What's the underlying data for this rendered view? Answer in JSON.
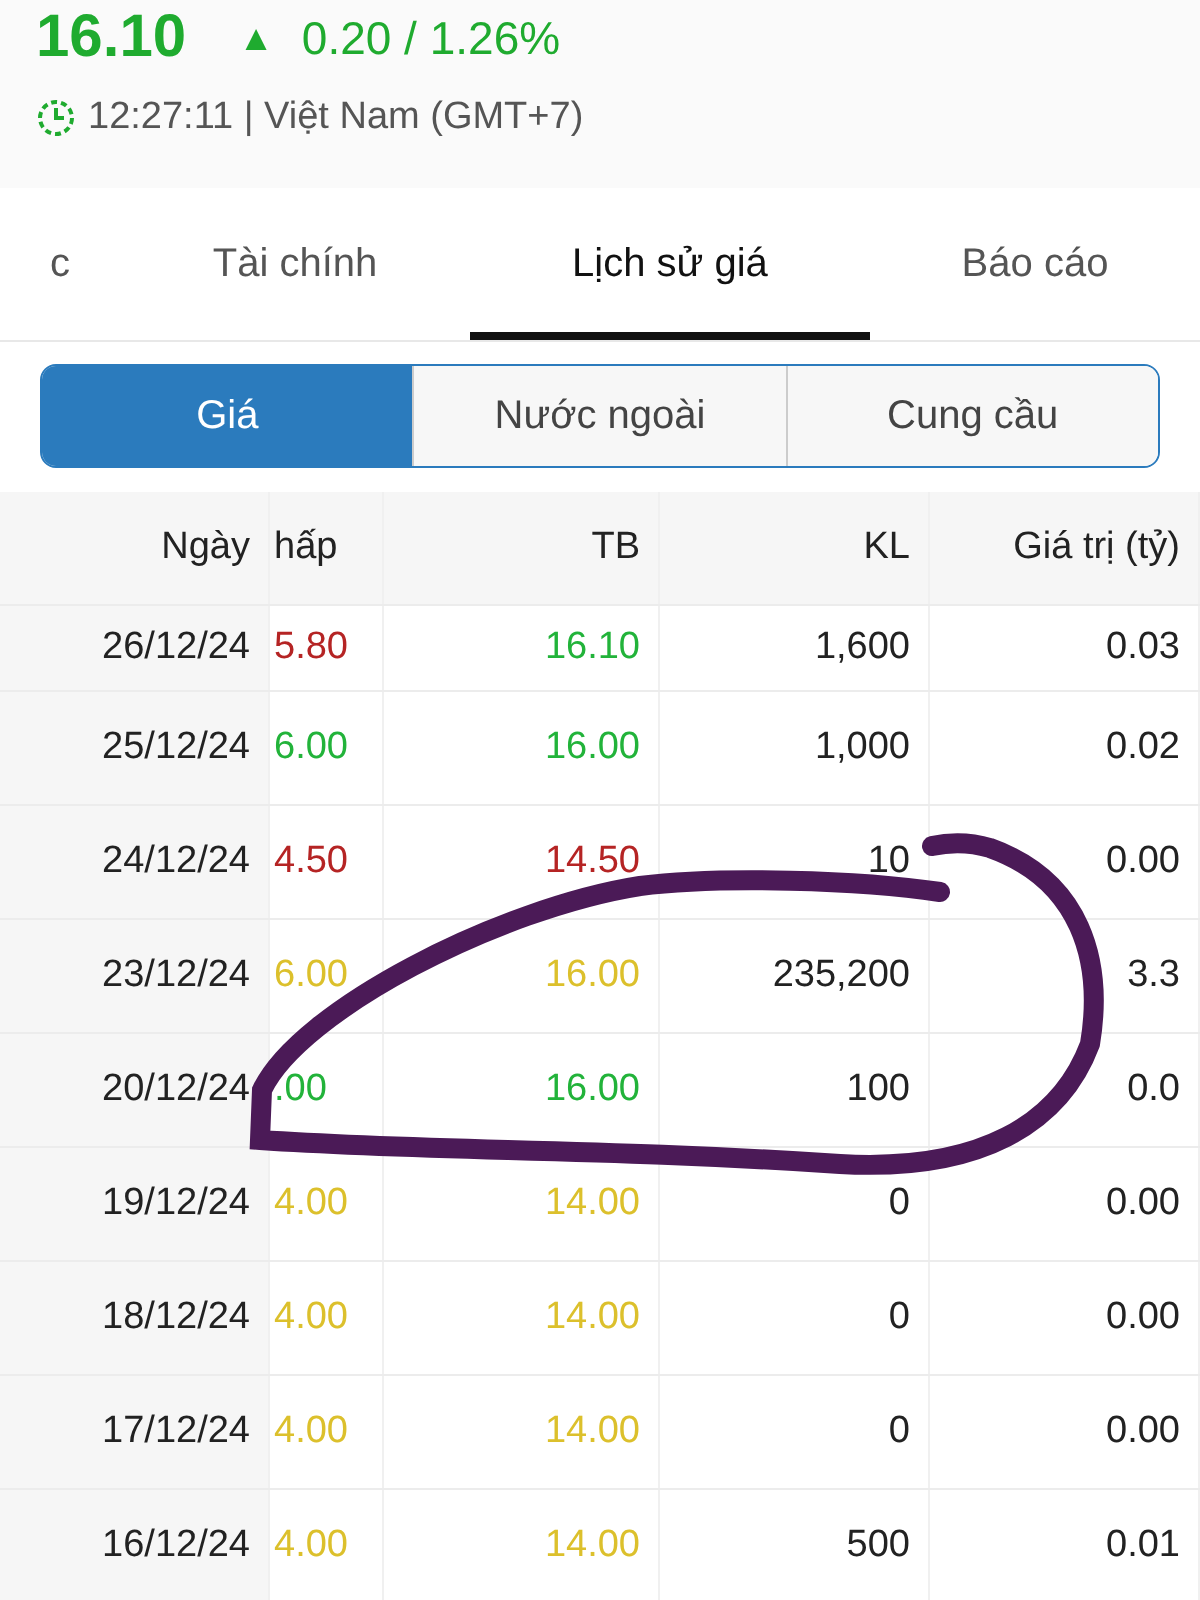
{
  "quote": {
    "price": "16.10",
    "arrow": "▲",
    "change": "0.20 / 1.26%",
    "time": "12:27:11 | Việt Nam (GMT+7)"
  },
  "tabs": [
    {
      "label": "c",
      "selected": false
    },
    {
      "label": "Tài chính",
      "selected": false
    },
    {
      "label": "Lịch sử giá",
      "selected": true
    },
    {
      "label": "Báo cáo",
      "selected": false
    }
  ],
  "segments": [
    {
      "label": "Giá",
      "selected": true
    },
    {
      "label": "Nước ngoài",
      "selected": false
    },
    {
      "label": "Cung cầu",
      "selected": false
    }
  ],
  "table": {
    "columns": [
      "Ngày",
      "hấp",
      "TB",
      "KL",
      "Giá trị (tỷ)"
    ],
    "rows": [
      {
        "date": "26/12/24",
        "low": {
          "text": "5.80",
          "color": "#b52424"
        },
        "avg": {
          "text": "16.10",
          "color": "#22b33a"
        },
        "volume": "1,600",
        "value": "0.03"
      },
      {
        "date": "25/12/24",
        "low": {
          "text": "6.00",
          "color": "#22b33a"
        },
        "avg": {
          "text": "16.00",
          "color": "#22b33a"
        },
        "volume": "1,000",
        "value": "0.02"
      },
      {
        "date": "24/12/24",
        "low": {
          "text": "4.50",
          "color": "#b52424"
        },
        "avg": {
          "text": "14.50",
          "color": "#b52424"
        },
        "volume": "10",
        "value": "0.00"
      },
      {
        "date": "23/12/24",
        "low": {
          "text": "6.00",
          "color": "#dcc02c"
        },
        "avg": {
          "text": "16.00",
          "color": "#dcc02c"
        },
        "volume": "235,200",
        "value": "3.3"
      },
      {
        "date": "20/12/24",
        "low": {
          "text": ".00",
          "color": "#22b33a"
        },
        "avg": {
          "text": "16.00",
          "color": "#22b33a"
        },
        "volume": "100",
        "value": "0.0"
      },
      {
        "date": "19/12/24",
        "low": {
          "text": "4.00",
          "color": "#dcc02c"
        },
        "avg": {
          "text": "14.00",
          "color": "#dcc02c"
        },
        "volume": "0",
        "value": "0.00"
      },
      {
        "date": "18/12/24",
        "low": {
          "text": "4.00",
          "color": "#dcc02c"
        },
        "avg": {
          "text": "14.00",
          "color": "#dcc02c"
        },
        "volume": "0",
        "value": "0.00"
      },
      {
        "date": "17/12/24",
        "low": {
          "text": "4.00",
          "color": "#dcc02c"
        },
        "avg": {
          "text": "14.00",
          "color": "#dcc02c"
        },
        "volume": "0",
        "value": "0.00"
      },
      {
        "date": "16/12/24",
        "low": {
          "text": "4.00",
          "color": "#dcc02c"
        },
        "avg": {
          "text": "14.00",
          "color": "#dcc02c"
        },
        "volume": "500",
        "value": "0.01"
      }
    ]
  }
}
